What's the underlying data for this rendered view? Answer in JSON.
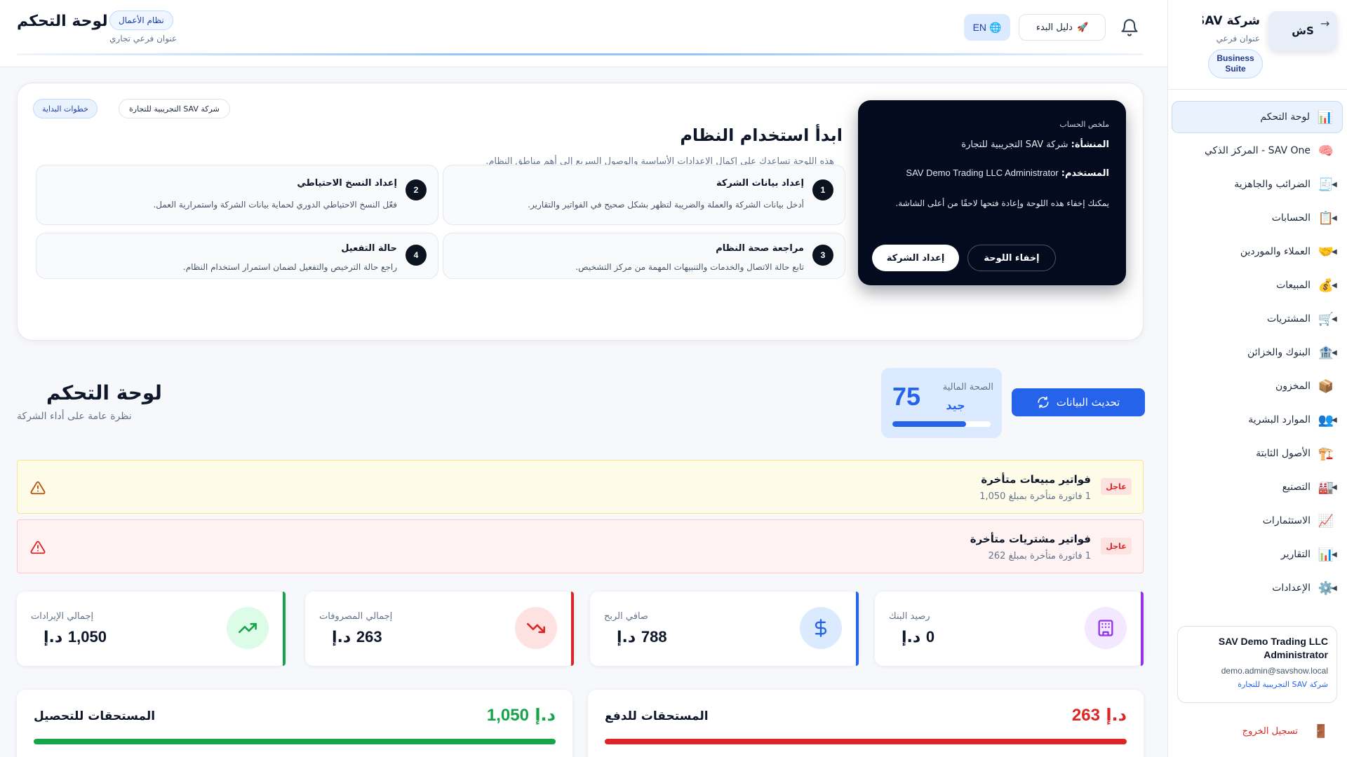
{
  "sidebar": {
    "logo_text": "ش",
    "logo_letter": "S",
    "company_name": "شركة SAV للتجارة",
    "company_sub": "عنوان فرعي",
    "suite_label": "Business Suite",
    "collapse_icon": "arrow-right-icon",
    "items": [
      {
        "label": "لوحة التحكم",
        "icon": "📊",
        "icon_name": "chart-icon",
        "active": true,
        "expandable": false
      },
      {
        "label": "SAV One - المركز الذكي",
        "icon": "🧠",
        "icon_name": "brain-icon",
        "active": false,
        "expandable": false
      },
      {
        "label": "الضرائب والجاهزية",
        "icon": "🧾",
        "icon_name": "receipt-icon",
        "active": false,
        "expandable": true
      },
      {
        "label": "الحسابات",
        "icon": "📋",
        "icon_name": "clipboard-icon",
        "active": false,
        "expandable": true
      },
      {
        "label": "العملاء والموردين",
        "icon": "🤝",
        "icon_name": "handshake-icon",
        "active": false,
        "expandable": true
      },
      {
        "label": "المبيعات",
        "icon": "💰",
        "icon_name": "money-bag-icon",
        "active": false,
        "expandable": true
      },
      {
        "label": "المشتريات",
        "icon": "🛒",
        "icon_name": "cart-icon",
        "active": false,
        "expandable": true
      },
      {
        "label": "البنوك والخزائن",
        "icon": "🏦",
        "icon_name": "bank-icon",
        "active": false,
        "expandable": true
      },
      {
        "label": "المخزون",
        "icon": "📦",
        "icon_name": "package-icon",
        "active": false,
        "expandable": false
      },
      {
        "label": "الموارد البشرية",
        "icon": "👥",
        "icon_name": "people-icon",
        "active": false,
        "expandable": true
      },
      {
        "label": "الأصول الثابتة",
        "icon": "🏗️",
        "icon_name": "building-construction-icon",
        "active": false,
        "expandable": false
      },
      {
        "label": "التصنيع",
        "icon": "🏭",
        "icon_name": "factory-icon",
        "active": false,
        "expandable": true
      },
      {
        "label": "الاستثمارات",
        "icon": "📈",
        "icon_name": "trend-up-icon",
        "active": false,
        "expandable": false
      },
      {
        "label": "التقارير",
        "icon": "📊",
        "icon_name": "report-chart-icon",
        "active": false,
        "expandable": true
      },
      {
        "label": "الإعدادات",
        "icon": "⚙️",
        "icon_name": "gear-icon",
        "active": false,
        "expandable": true
      }
    ],
    "user": {
      "name": "SAV Demo Trading LLC Administrator",
      "email": "demo.admin@savshow.local",
      "company": "شركة SAV التجريبية للتجارة"
    },
    "logout_label": "تسجيل الخروج",
    "logout_icon": "🚪"
  },
  "topbar": {
    "title": "لوحة التحكم",
    "badge": "نظام الأعمال",
    "subtitle": "عنوان فرعي تجاري",
    "guide_label": "دليل البدء",
    "guide_icon": "🚀",
    "lang_label": "EN",
    "lang_icon": "🌐"
  },
  "onboarding": {
    "tag_start": "خطوات البداية",
    "tag_company": "شركة SAV التجريبية للتجارة",
    "title": "ابدأ استخدام النظام",
    "description": "هذه اللوحة تساعدك على إكمال الإعدادات الأساسية والوصول السريع إلى أهم مناطق النظام.",
    "account": {
      "heading": "ملخص الحساب",
      "company_key": "المنشأة:",
      "company_value": "شركة SAV التجريبية للتجارة",
      "user_key": "المستخدم:",
      "user_value": "SAV Demo Trading LLC Administrator",
      "note": "يمكنك إخفاء هذه اللوحة وإعادة فتحها لاحقًا من أعلى الشاشة.",
      "setup_button": "إعداد الشركة",
      "hide_button": "إخفاء اللوحة"
    },
    "steps": [
      {
        "num": "1",
        "title": "إعداد بيانات الشركة",
        "desc": "أدخل بيانات الشركة والعملة والضريبة لتظهر بشكل صحيح في الفواتير والتقارير."
      },
      {
        "num": "2",
        "title": "إعداد النسخ الاحتياطي",
        "desc": "فعّل النسخ الاحتياطي الدوري لحماية بيانات الشركة واستمرارية العمل."
      },
      {
        "num": "3",
        "title": "مراجعة صحة النظام",
        "desc": "تابع حالة الاتصال والخدمات والتنبيهات المهمة من مركز التشخيص."
      },
      {
        "num": "4",
        "title": "حالة التفعيل",
        "desc": "راجع حالة الترخيص والتفعيل لضمان استمرار استخدام النظام."
      }
    ]
  },
  "dashboard": {
    "title": "لوحة التحكم",
    "subtitle": "نظرة عامة على أداء الشركة",
    "refresh_label": "تحديث البيانات",
    "health": {
      "label": "الصحة المالية",
      "score": "75",
      "status": "جيد",
      "fraction": 0.75
    }
  },
  "alerts": [
    {
      "badge": "عاجل",
      "title": "فواتير مبيعات متأخرة",
      "desc": "1 فاتورة متأخرة بمبلغ 1,050",
      "kind": "warning"
    },
    {
      "badge": "عاجل",
      "title": "فواتير مشتريات متأخرة",
      "desc": "1 فاتورة متأخرة بمبلغ 262",
      "kind": "error"
    }
  ],
  "kpis": [
    {
      "label": "رصيد البنك",
      "value": "0",
      "currency": "د.إ",
      "icon": "bank-building-icon",
      "color": "#9333ea",
      "bg": "#f3e8ff"
    },
    {
      "label": "صافي الربح",
      "value": "788",
      "currency": "د.إ",
      "icon": "dollar-icon",
      "color": "#2563eb",
      "bg": "#dbeafe"
    },
    {
      "label": "إجمالي المصروفات",
      "value": "263",
      "currency": "د.إ",
      "icon": "trend-down-icon",
      "color": "#dc2626",
      "bg": "#fee2e2"
    },
    {
      "label": "إجمالي الإيرادات",
      "value": "1,050",
      "currency": "د.إ",
      "icon": "trend-up-icon",
      "color": "#16a34a",
      "bg": "#dcfce7"
    }
  ],
  "summaries": [
    {
      "title": "المستحقات للدفع",
      "amount": "263",
      "currency": "د.إ",
      "color": "#dc2626"
    },
    {
      "title": "المستحقات للتحصيل",
      "amount": "1,050",
      "currency": "د.إ",
      "color": "#16a34a"
    }
  ]
}
